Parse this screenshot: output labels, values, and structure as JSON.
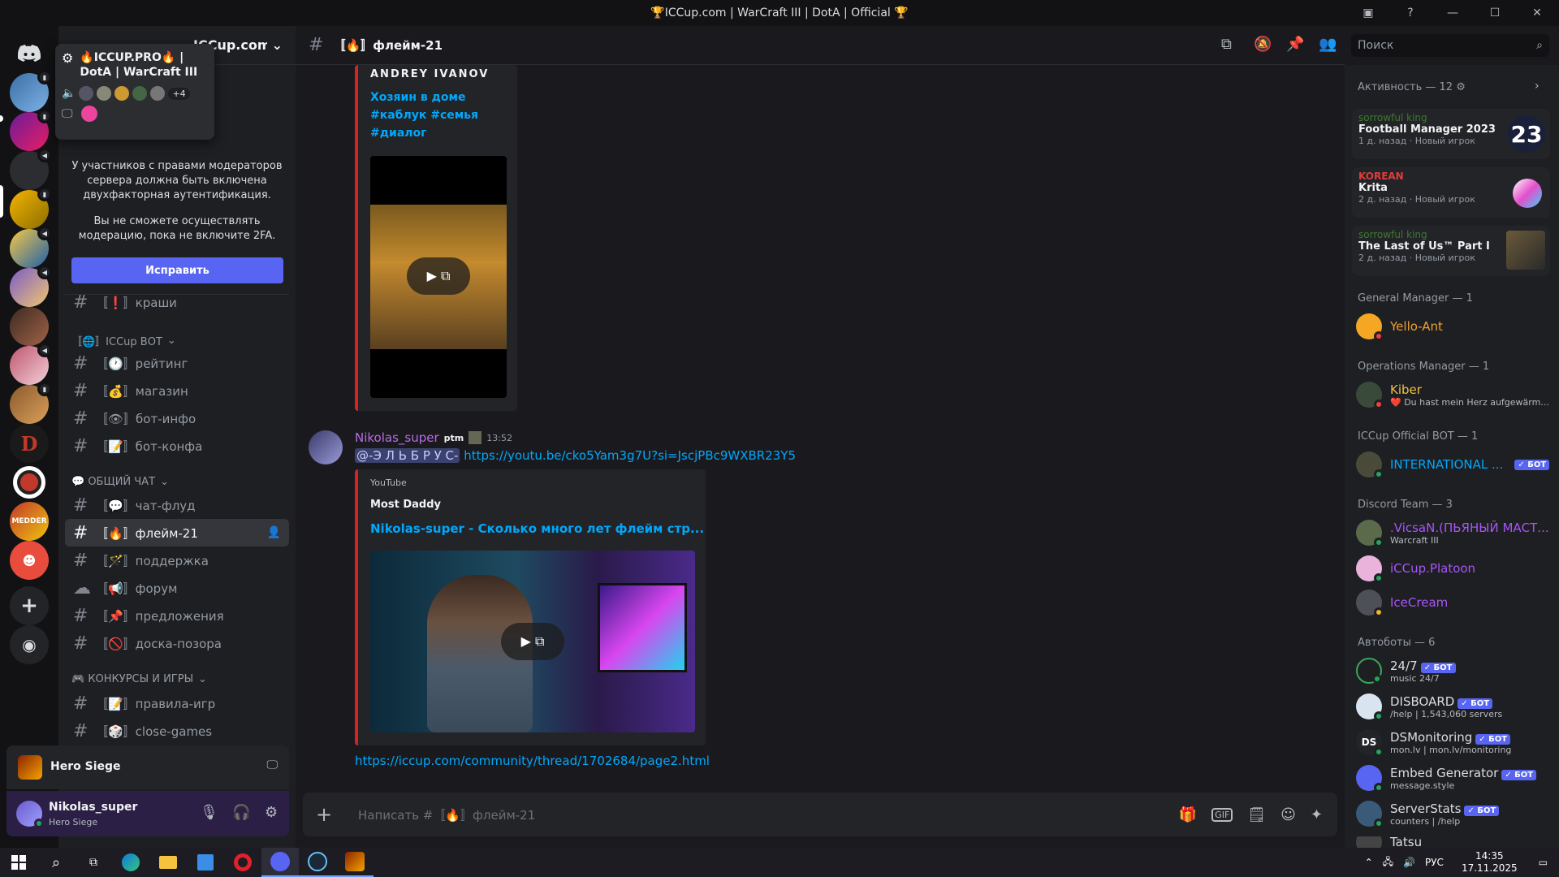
{
  "window": {
    "title": "🏆ICCup.com | WarCraft III | DotA | Official 🏆"
  },
  "server": {
    "name": "ICCup.com | WarCraft III | ...",
    "popup_name": "🔥ICCUP.PRO🔥 | DotA | WarCraft III",
    "popup_more": "+4"
  },
  "mod_notice": {
    "line1": "У участников с правами модераторов сервера должна быть включена двухфакторная аутентификация.",
    "line2": "Вы не сможете осуществлять модерацию, пока не включите 2FA.",
    "button": "Исправить"
  },
  "channels": {
    "kraschi": "〚❗〛краши",
    "cat_bot": "〚🌐〛ICCup ВОТ",
    "rating": "〚🕐〛рейтинг",
    "shop": "〚💰〛магазин",
    "botinfo": "〚👁〛бот-инфо",
    "botconf": "〚📝〛бот-конфа",
    "cat_general": "💬 ОБЩИЙ ЧАТ",
    "chatflood": "〚💬〛чат-флуд",
    "flame": "〚🔥〛флейм-21",
    "support": "〚🪄〛поддержка",
    "forum": "〚📢〛форум",
    "suggestions": "〚📌〛предложения",
    "shame": "〚🚫〛доска-позора",
    "cat_games": "🎮 КОНКУРСЫ И ИГРЫ",
    "gamerules": "〚📝〛правила-игр",
    "closegames": "〚🎲〛close-games"
  },
  "voice_activity": {
    "game": "Hero Siege"
  },
  "user": {
    "name": "Nikolas_super",
    "status": "Hero Siege"
  },
  "chat": {
    "channel": "〚🔥〛флейм-21",
    "search_placeholder": "Поиск",
    "composer_placeholder": "Написать #〚🔥〛флейм-21",
    "embed1": {
      "author": "ANDREY IVANOV",
      "line1": "Хозяин в доме",
      "line2": "#каблук #семья",
      "line3": "#диалог"
    },
    "message": {
      "author": "Nikolas_super",
      "tag": "ptm",
      "time": "13:52",
      "mention": "@-Э Л Ь Б Р У С-",
      "url": "https://youtu.be/cko5Yam3g7U?si=JscjPBc9WXBR23Y5",
      "provider": "YouTube",
      "embed_author": "Most Daddy",
      "embed_title": "Nikolas-super - Сколько много лет флейм стр...",
      "link2": "https://iccup.com/community/thread/1702684/page2.html"
    }
  },
  "members": {
    "activity_header": "Активность — 12 ⚙",
    "activities": [
      {
        "user": "sorrowful king",
        "game": "Football Manager 2023",
        "time": "1 д. назад",
        "tag": "Новый игрок"
      },
      {
        "user": "KOREAN",
        "game": "Krita",
        "time": "2 д. назад",
        "tag": "Новый игрок"
      },
      {
        "user": "sorrowful king",
        "game": "The Last of Us™ Part I",
        "time": "2 д. назад",
        "tag": "Новый игрок"
      }
    ],
    "groups": {
      "gm": "General Manager — 1",
      "om": "Operations Manager — 1",
      "bot": "ICCup Official BOT — 1",
      "team": "Discord Team — 3",
      "autobots": "Автоботы — 6"
    },
    "list": {
      "yello": "Yello-Ant",
      "kiber": "Kiber",
      "kiber_status": "❤️ Du hast mein Herz aufgewärm...",
      "intl": "INTERNATIONAL ...",
      "vicsan": ".VicsaN.(ПЬЯНЫЙ МАСТ...",
      "vicsan_sub": "Warcraft III",
      "platoon": "iCCup.Platoon",
      "icecream": "IceCream",
      "b247": "24/7",
      "b247_sub": "music 24/7",
      "disboard": "DISBOARD",
      "disboard_sub": "/help | 1,543,060 servers",
      "dsmon": "DSMonitoring",
      "dsmon_sub": "mon.lv | mon.lv/monitoring",
      "embedgen": "Embed Generator",
      "embedgen_sub": "message.style",
      "serverstats": "ServerStats",
      "serverstats_sub": "counters | /help",
      "tatsu": "Tatsu"
    },
    "bot_label": "✓ БОТ"
  },
  "taskbar": {
    "lang": "РУС",
    "time": "14:35",
    "date": "17.11.2025"
  }
}
